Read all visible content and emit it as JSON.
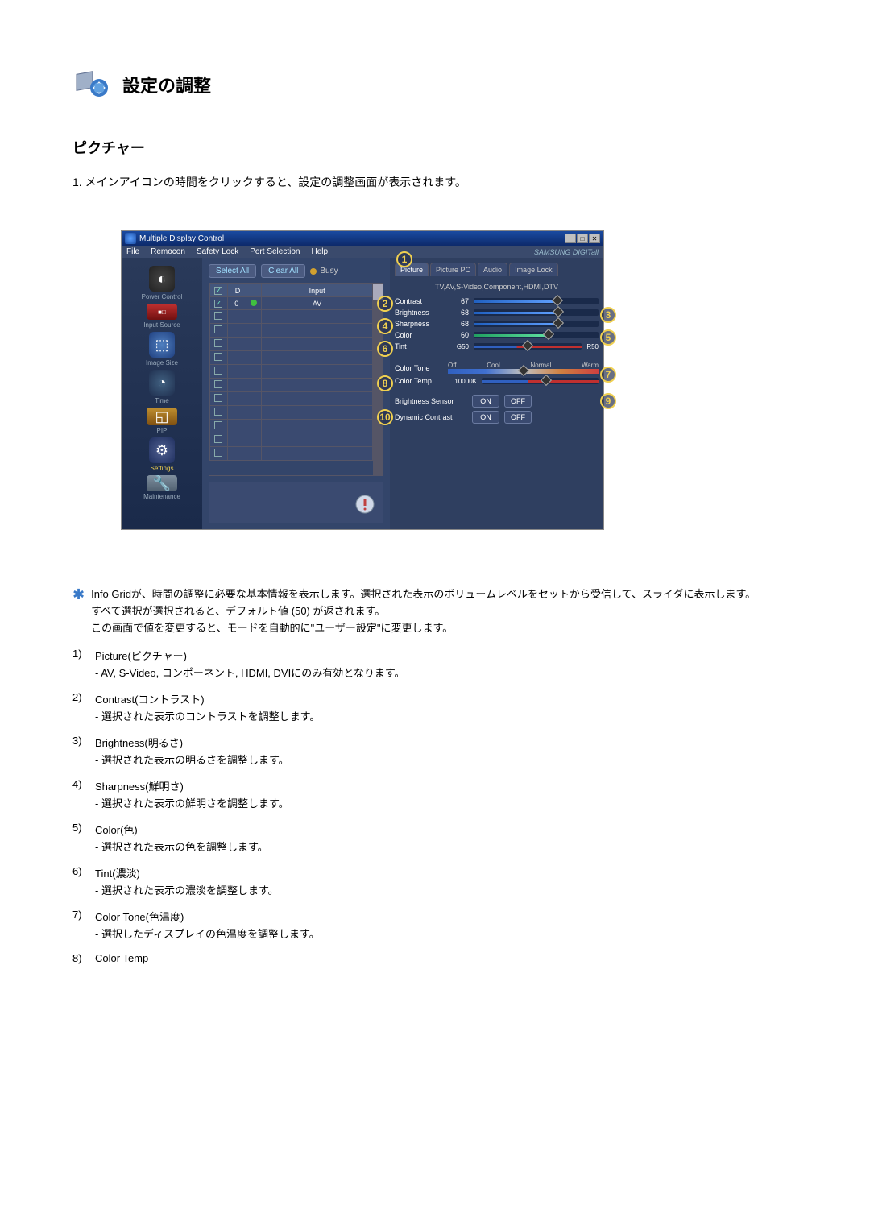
{
  "header": {
    "title": "設定の調整"
  },
  "section_title": "ピクチャー",
  "intro": "1.  メインアイコンの時間をクリックすると、設定の調整画面が表示されます。",
  "app": {
    "title": "Multiple Display Control",
    "menus": [
      "File",
      "Remocon",
      "Safety Lock",
      "Port Selection",
      "Help"
    ],
    "brand": "SAMSUNG DIGITall",
    "toolbar": {
      "select_all": "Select All",
      "clear_all": "Clear All",
      "busy": "Busy"
    },
    "grid": {
      "headers": {
        "id": "ID",
        "input": "Input"
      },
      "row1_id": "0",
      "row1_input": "AV"
    },
    "sidebar": {
      "power": "Power Control",
      "input": "Input Source",
      "image": "Image Size",
      "time": "Time",
      "pip": "PIP",
      "settings": "Settings",
      "maint": "Maintenance"
    },
    "tabs": {
      "picture": "Picture",
      "picture_pc": "Picture PC",
      "audio": "Audio",
      "image_lock": "Image Lock"
    },
    "sub_info": "TV,AV,S-Video,Component,HDMI,DTV",
    "controls": {
      "contrast": {
        "label": "Contrast",
        "value": "67"
      },
      "brightness": {
        "label": "Brightness",
        "value": "68"
      },
      "sharpness": {
        "label": "Sharpness",
        "value": "68"
      },
      "color": {
        "label": "Color",
        "value": "60"
      },
      "tint": {
        "label": "Tint",
        "left": "G50",
        "right": "R50"
      },
      "color_tone": {
        "label": "Color Tone",
        "opts": [
          "Off",
          "Cool",
          "Normal",
          "Warm"
        ]
      },
      "color_temp": {
        "label": "Color Temp",
        "value": "10000K"
      },
      "bright_sensor": {
        "label": "Brightness Sensor",
        "on": "ON",
        "off": "OFF"
      },
      "dyn_contrast": {
        "label": "Dynamic Contrast",
        "on": "ON",
        "off": "OFF"
      }
    },
    "callouts": [
      "1",
      "2",
      "3",
      "4",
      "5",
      "6",
      "7",
      "8",
      "9",
      "10"
    ]
  },
  "notes": {
    "star1": "Info Gridが、時間の調整に必要な基本情報を表示します。選択された表示のボリュームレベルをセットから受信して、スライダに表示します。",
    "star2": "すべて選択が選択されると、デフォルト値 (50) が返されます。",
    "star3": "この画面で値を変更すると、モードを自動的に\"ユーザー設定\"に変更します。",
    "items": [
      {
        "n": "1)",
        "t": "Picture(ピクチャー)",
        "d": "- AV, S-Video, コンポーネント, HDMI, DVIにのみ有効となります。"
      },
      {
        "n": "2)",
        "t": "Contrast(コントラスト)",
        "d": "- 選択された表示のコントラストを調整します。"
      },
      {
        "n": "3)",
        "t": "Brightness(明るさ)",
        "d": "- 選択された表示の明るさを調整します。"
      },
      {
        "n": "4)",
        "t": "Sharpness(鮮明さ)",
        "d": "- 選択された表示の鮮明さを調整します。"
      },
      {
        "n": "5)",
        "t": "Color(色)",
        "d": "- 選択された表示の色を調整します。"
      },
      {
        "n": "6)",
        "t": "Tint(濃淡)",
        "d": "- 選択された表示の濃淡を調整します。"
      },
      {
        "n": "7)",
        "t": "Color Tone(色温度)",
        "d": "- 選択したディスプレイの色温度を調整します。"
      },
      {
        "n": "8)",
        "t": "Color Temp",
        "d": ""
      }
    ]
  }
}
